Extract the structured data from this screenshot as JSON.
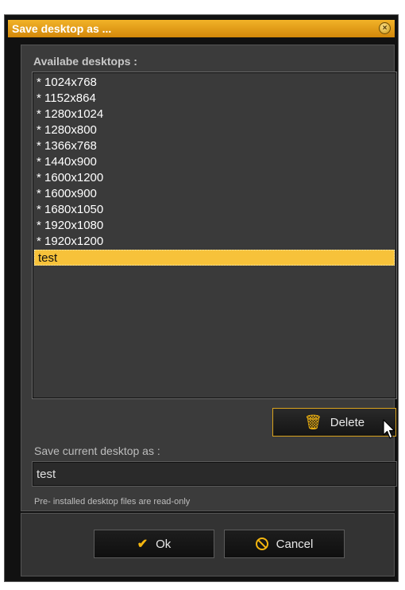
{
  "dialog": {
    "title": "Save desktop as ...",
    "close_icon": "close-circle-icon"
  },
  "list": {
    "label": "Availabe desktops :",
    "items": [
      "* 1024x768",
      "* 1152x864",
      "* 1280x1024",
      "* 1280x800",
      "* 1366x768",
      "* 1440x900",
      "* 1600x1200",
      "* 1600x900",
      "* 1680x1050",
      "* 1920x1080",
      "* 1920x1200",
      "test"
    ],
    "selected": "test"
  },
  "delete_button": {
    "label": "Delete",
    "icon": "trash-icon"
  },
  "save": {
    "label": "Save current desktop as :",
    "value": "test"
  },
  "note": "Pre- installed desktop files are read-only",
  "buttons": {
    "ok_label": "Ok",
    "ok_icon": "check-icon",
    "cancel_label": "Cancel",
    "cancel_icon": "cancel-icon"
  },
  "colors": {
    "accent": "#f5b60f",
    "title_bar": "#e9a21e",
    "selection": "#f7c23a"
  }
}
